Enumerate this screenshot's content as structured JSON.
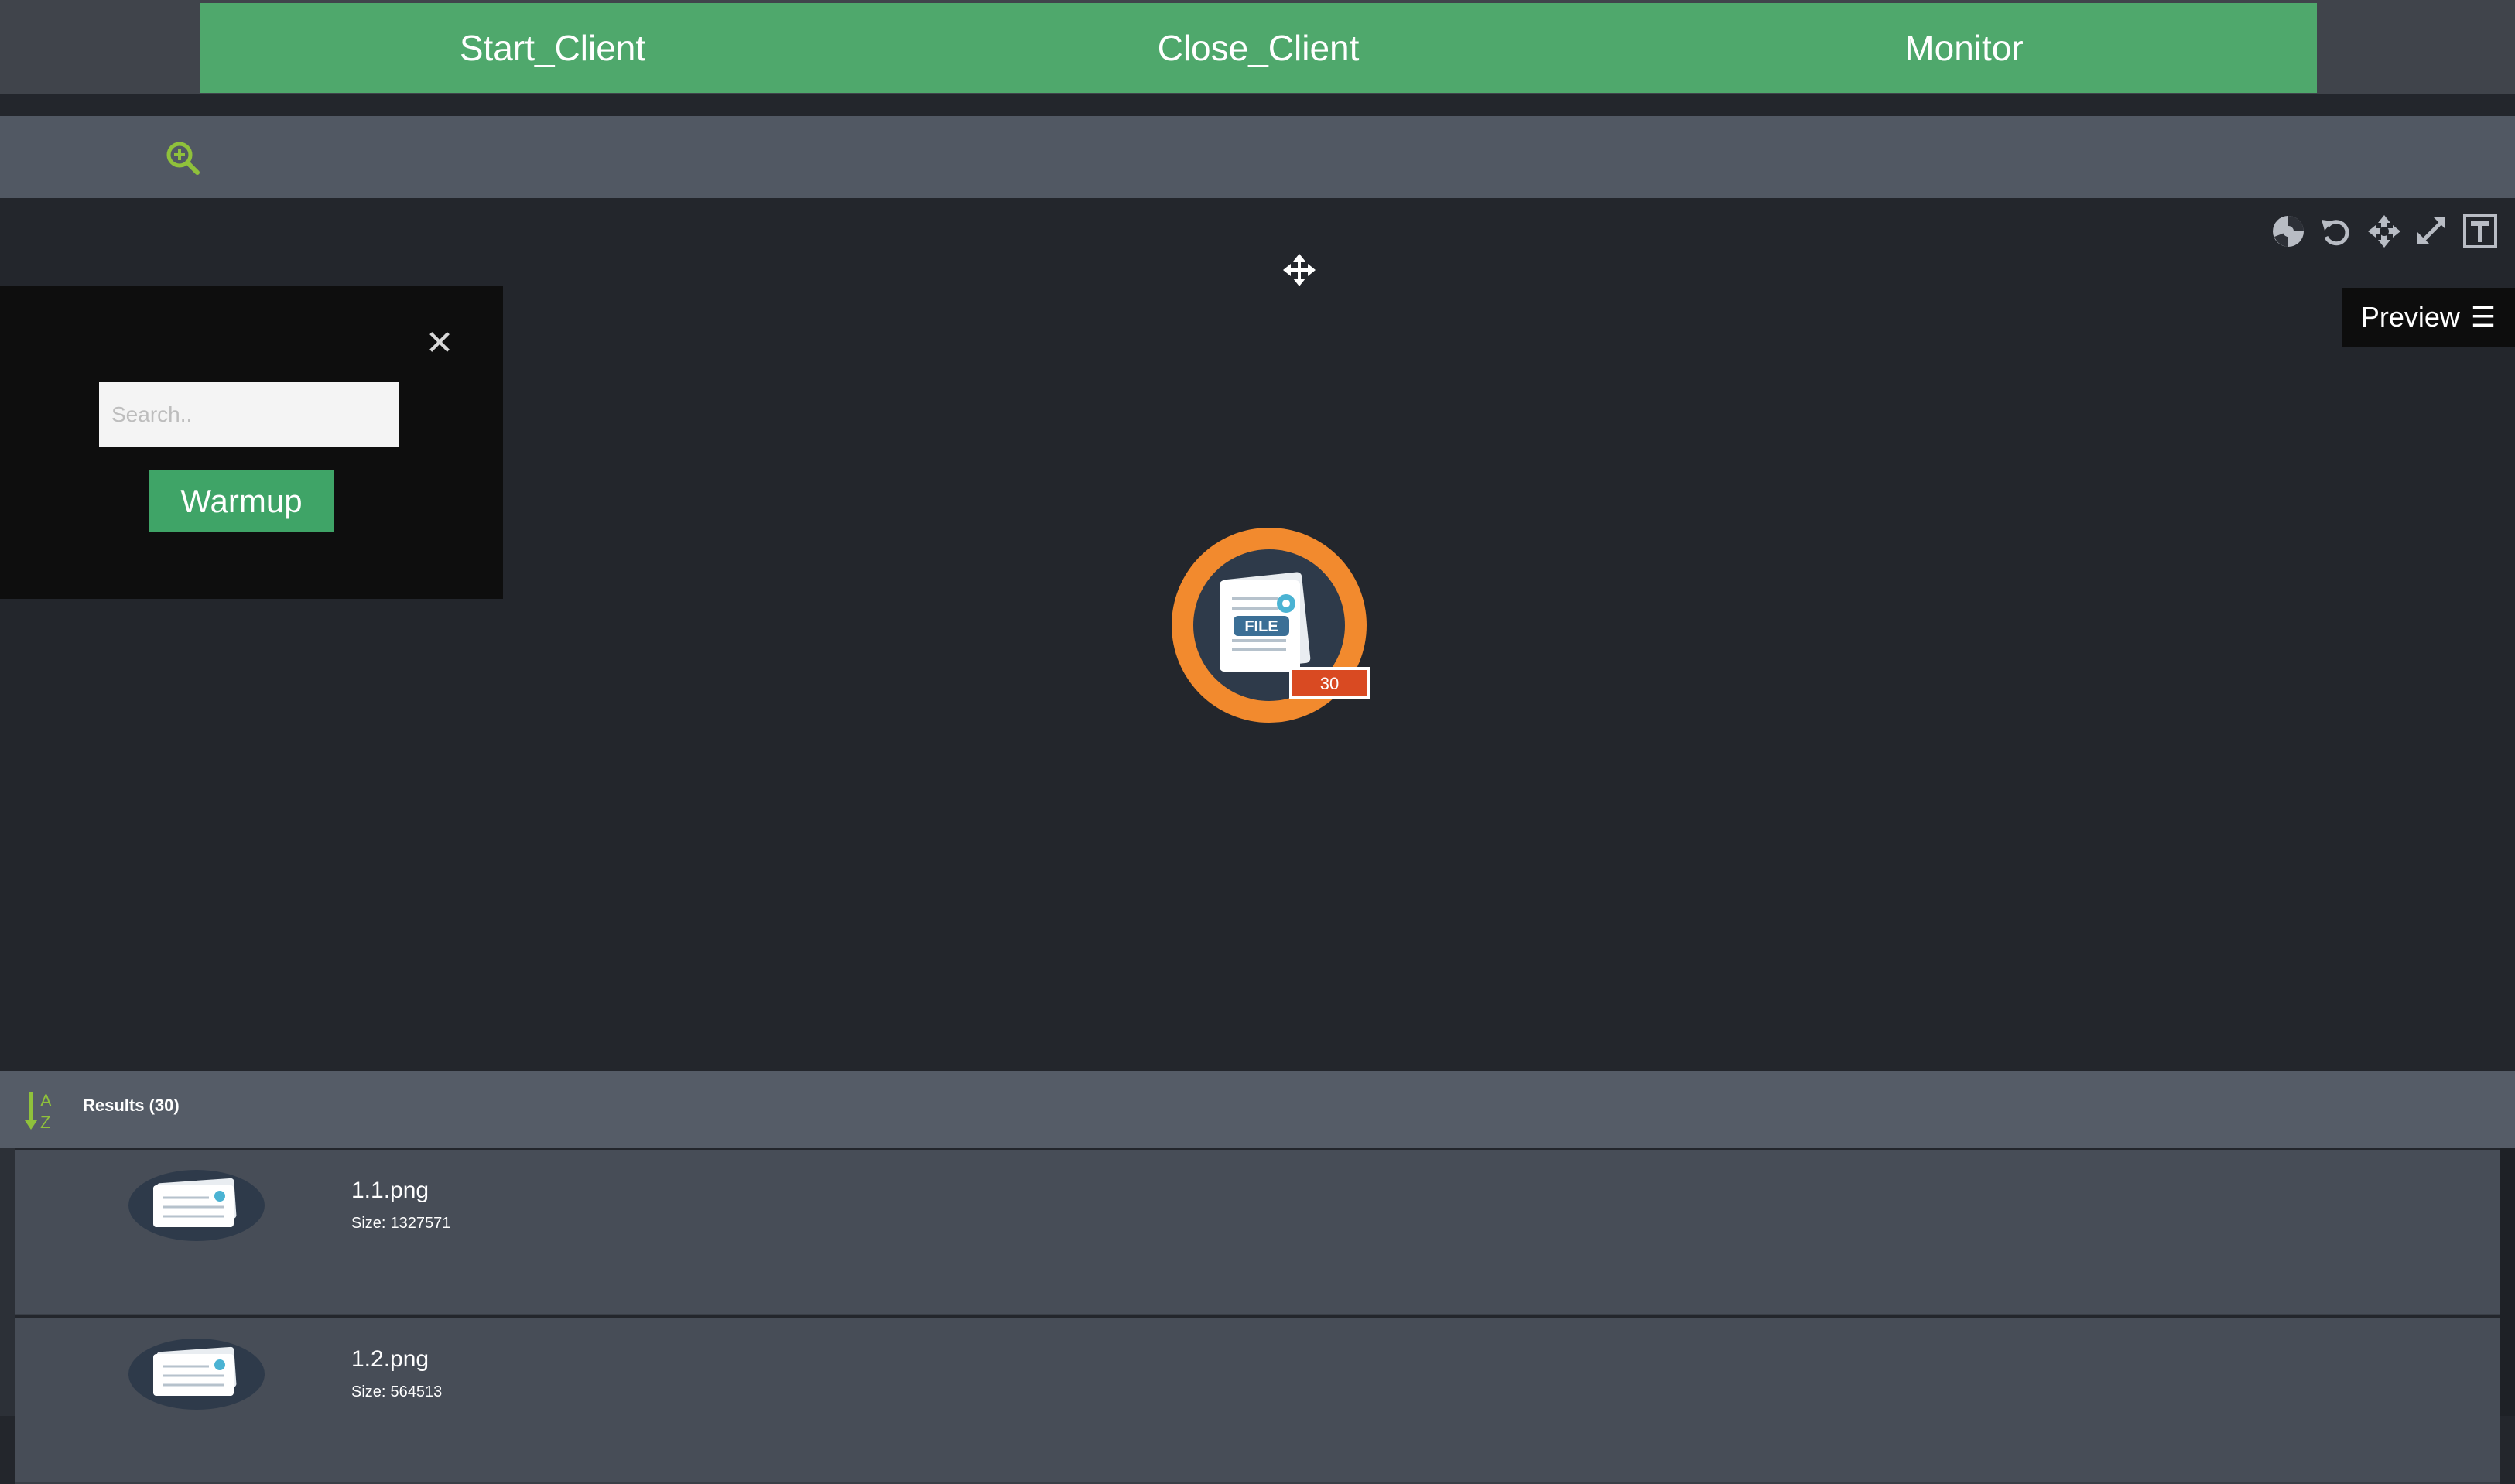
{
  "topnav": {
    "items": [
      {
        "label": "Start_Client"
      },
      {
        "label": "Close_Client"
      },
      {
        "label": "Monitor"
      }
    ],
    "color": "#4fa86c"
  },
  "toolbar": {
    "zoom_icon": "zoom-in-icon"
  },
  "graph_tools": [
    "color-palette-icon",
    "undo-icon",
    "move-center-icon",
    "expand-icon",
    "text-icon"
  ],
  "preview": {
    "label": "Preview",
    "icon": "hamburger-menu-icon"
  },
  "search_panel": {
    "placeholder": "Search..",
    "value": "",
    "button_label": "Warmup",
    "close_icon": "close-icon"
  },
  "node": {
    "icon_label": "FILE",
    "badge_count": "30",
    "ring_color": "#f28a2e",
    "badge_color": "#d94a22"
  },
  "results": {
    "label": "Results (30)",
    "sort_icon": "sort-alpha-icon",
    "items": [
      {
        "name": "1.1.png",
        "size_label": "Size:",
        "size": "1327571"
      },
      {
        "name": "1.2.png",
        "size_label": "Size:",
        "size": "564513"
      }
    ]
  }
}
